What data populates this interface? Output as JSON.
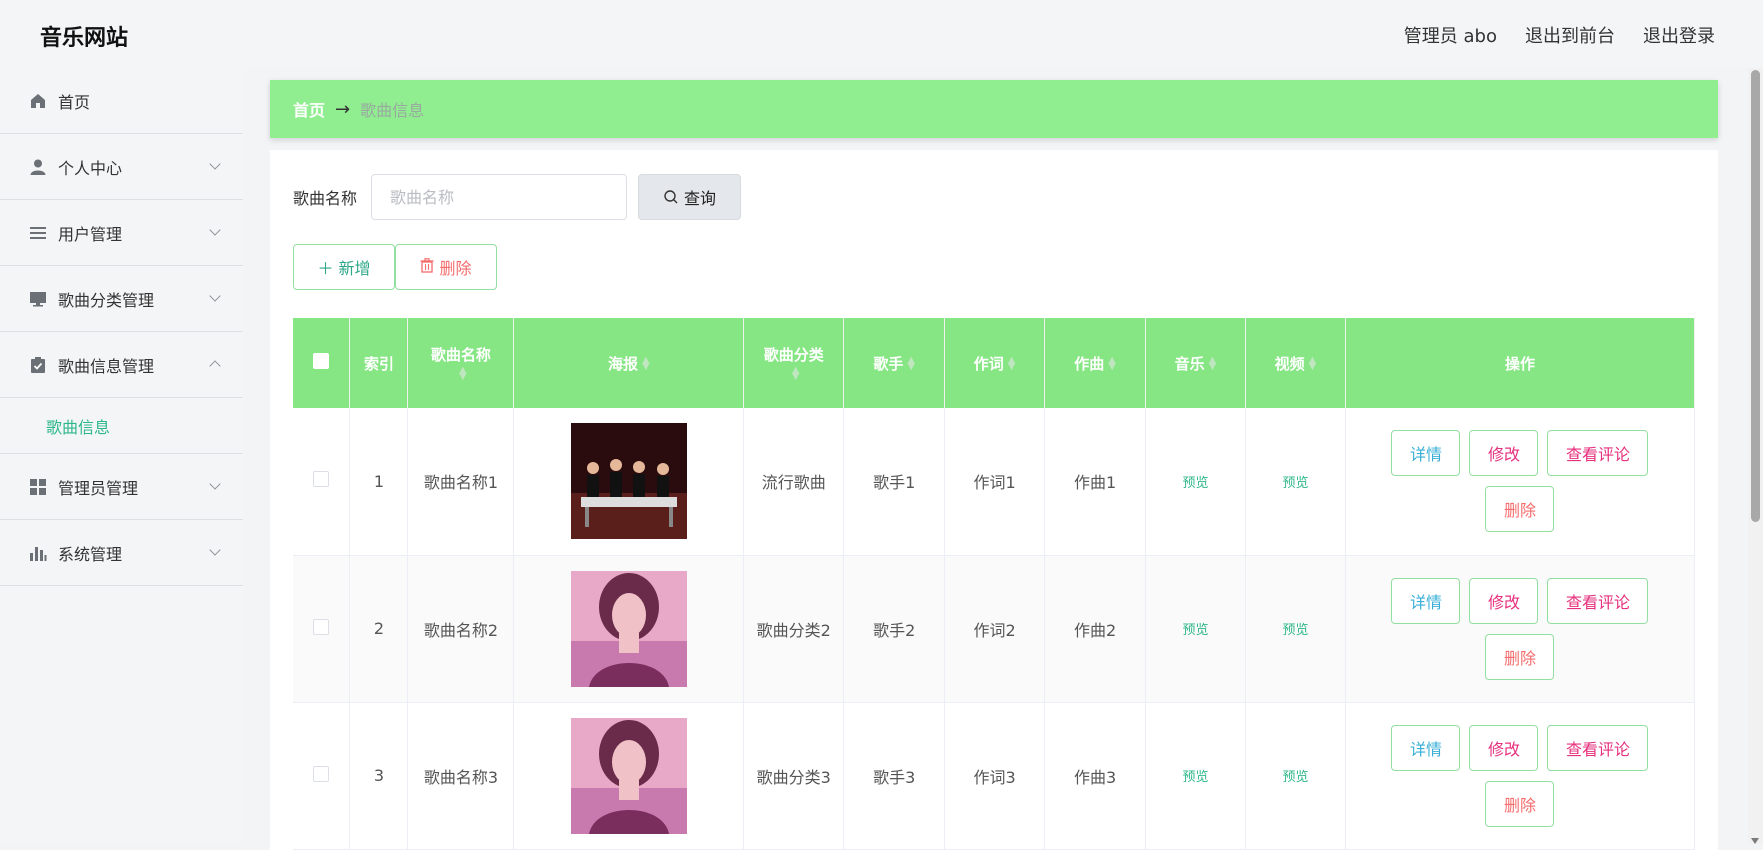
{
  "header": {
    "title": "音乐网站",
    "admin_label": "管理员 abo",
    "to_front_label": "退出到前台",
    "logout_label": "退出登录"
  },
  "sidebar": {
    "items": [
      {
        "label": "首页",
        "icon": "home-icon"
      },
      {
        "label": "个人中心",
        "icon": "user-icon"
      },
      {
        "label": "用户管理",
        "icon": "list-icon"
      },
      {
        "label": "歌曲分类管理",
        "icon": "monitor-icon"
      },
      {
        "label": "歌曲信息管理",
        "icon": "clipboard-icon"
      },
      {
        "label": "管理员管理",
        "icon": "grid-icon"
      },
      {
        "label": "系统管理",
        "icon": "bar-chart-icon"
      }
    ],
    "submenu_label": "歌曲信息"
  },
  "breadcrumb": {
    "home": "首页",
    "arrow": "→",
    "current": "歌曲信息"
  },
  "search": {
    "label": "歌曲名称",
    "placeholder": "歌曲名称",
    "value": "",
    "button_label": "查询"
  },
  "actions": {
    "add_label": "新增",
    "delete_label": "删除"
  },
  "table": {
    "headers": [
      "索引",
      "歌曲名称",
      "海报",
      "歌曲分类",
      "歌手",
      "作词",
      "作曲",
      "音乐",
      "视频",
      "操作"
    ],
    "rows": [
      {
        "index": "1",
        "name": "歌曲名称1",
        "category": "流行歌曲",
        "singer": "歌手1",
        "lyricist": "作词1",
        "composer": "作曲1",
        "music": "预览",
        "video": "预览",
        "poster": "drummers-photo"
      },
      {
        "index": "2",
        "name": "歌曲名称2",
        "category": "歌曲分类2",
        "singer": "歌手2",
        "lyricist": "作词2",
        "composer": "作曲2",
        "music": "预览",
        "video": "预览",
        "poster": "singer-portrait"
      },
      {
        "index": "3",
        "name": "歌曲名称3",
        "category": "歌曲分类3",
        "singer": "歌手3",
        "lyricist": "作词3",
        "composer": "作曲3",
        "music": "预览",
        "video": "预览",
        "poster": "singer-portrait"
      }
    ],
    "row_actions": {
      "detail": "详情",
      "edit": "修改",
      "comments": "查看评论",
      "delete": "删除"
    }
  },
  "colors": {
    "accent_green": "#90ee90",
    "table_header": "#86e683",
    "active_text": "#2eb78a"
  }
}
